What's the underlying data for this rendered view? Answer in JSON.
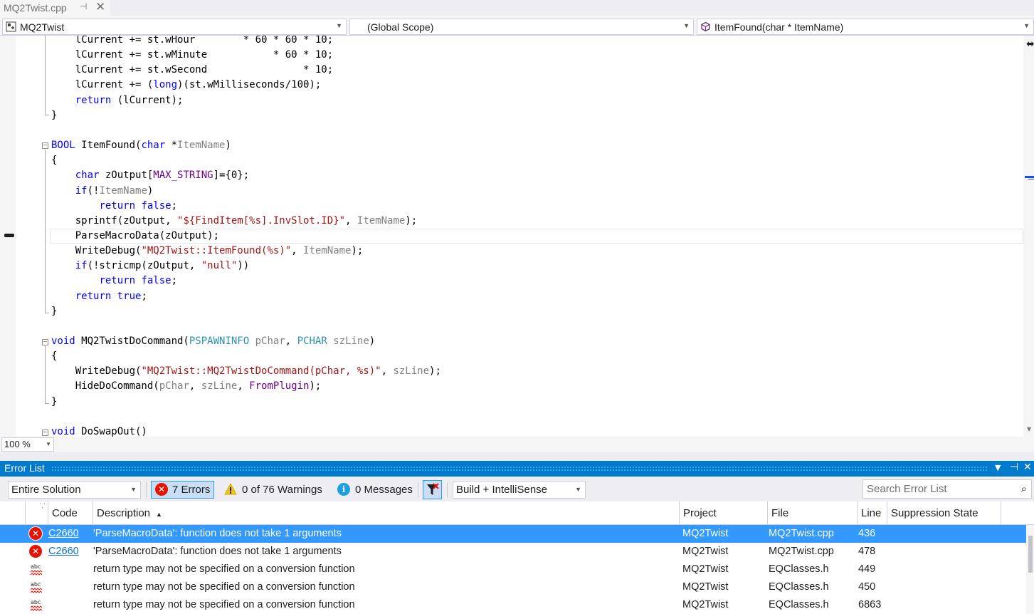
{
  "tab": {
    "filename": "MQ2Twist.cpp"
  },
  "navbar": {
    "project": "MQ2Twist",
    "scope": "(Global Scope)",
    "member": "ItemFound(char * ItemName)"
  },
  "zoom": "100 %",
  "code_lines": [
    [
      [
        "t",
        "    lCurrent += st.wHour        * 60 * 60 * 10;"
      ]
    ],
    [
      [
        "t",
        "    lCurrent += st.wMinute           * 60 * 10;"
      ]
    ],
    [
      [
        "t",
        "    lCurrent += st.wSecond                * 10;"
      ]
    ],
    [
      [
        "t",
        "    lCurrent += ("
      ],
      [
        "kw",
        "long"
      ],
      [
        "t",
        ")(st.wMilliseconds/100);"
      ]
    ],
    [
      [
        "t",
        "    "
      ],
      [
        "kw",
        "return"
      ],
      [
        "t",
        " (lCurrent);"
      ]
    ],
    [
      [
        "t",
        "}"
      ]
    ],
    [
      [
        "t",
        ""
      ]
    ],
    [
      [
        "kw",
        "BOOL"
      ],
      [
        "t",
        " ItemFound("
      ],
      [
        "kw",
        "char"
      ],
      [
        "t",
        " *"
      ],
      [
        "prm",
        "ItemName"
      ],
      [
        "t",
        ")"
      ]
    ],
    [
      [
        "t",
        "{"
      ]
    ],
    [
      [
        "t",
        "    "
      ],
      [
        "kw",
        "char"
      ],
      [
        "t",
        " zOutput["
      ],
      [
        "mac",
        "MAX_STRING"
      ],
      [
        "t",
        "]={0};"
      ]
    ],
    [
      [
        "t",
        "    "
      ],
      [
        "kw",
        "if"
      ],
      [
        "t",
        "(!"
      ],
      [
        "prm",
        "ItemName"
      ],
      [
        "t",
        ")"
      ]
    ],
    [
      [
        "t",
        "        "
      ],
      [
        "kw",
        "return"
      ],
      [
        "t",
        " "
      ],
      [
        "kw",
        "false"
      ],
      [
        "t",
        ";"
      ]
    ],
    [
      [
        "t",
        "    sprintf(zOutput, "
      ],
      [
        "str",
        "\"${FindItem[%s].InvSlot.ID}\""
      ],
      [
        "t",
        ", "
      ],
      [
        "prm",
        "ItemName"
      ],
      [
        "t",
        ");"
      ]
    ],
    [
      [
        "t",
        "    ParseMacroData(zOutput);"
      ]
    ],
    [
      [
        "t",
        "    WriteDebug("
      ],
      [
        "str",
        "\"MQ2Twist::ItemFound(%s)\""
      ],
      [
        "t",
        ", "
      ],
      [
        "prm",
        "ItemName"
      ],
      [
        "t",
        ");"
      ]
    ],
    [
      [
        "t",
        "    "
      ],
      [
        "kw",
        "if"
      ],
      [
        "t",
        "(!stricmp(zOutput, "
      ],
      [
        "str",
        "\"null\""
      ],
      [
        "t",
        "))"
      ]
    ],
    [
      [
        "t",
        "        "
      ],
      [
        "kw",
        "return"
      ],
      [
        "t",
        " "
      ],
      [
        "kw",
        "false"
      ],
      [
        "t",
        ";"
      ]
    ],
    [
      [
        "t",
        "    "
      ],
      [
        "kw",
        "return"
      ],
      [
        "t",
        " "
      ],
      [
        "kw",
        "true"
      ],
      [
        "t",
        ";"
      ]
    ],
    [
      [
        "t",
        "}"
      ]
    ],
    [
      [
        "t",
        ""
      ]
    ],
    [
      [
        "kw",
        "void"
      ],
      [
        "t",
        " MQ2TwistDoCommand("
      ],
      [
        "typ",
        "PSPAWNINFO"
      ],
      [
        "t",
        " "
      ],
      [
        "prm",
        "pChar"
      ],
      [
        "t",
        ", "
      ],
      [
        "typ",
        "PCHAR"
      ],
      [
        "t",
        " "
      ],
      [
        "prm",
        "szLine"
      ],
      [
        "t",
        ")"
      ]
    ],
    [
      [
        "t",
        "{"
      ]
    ],
    [
      [
        "t",
        "    WriteDebug("
      ],
      [
        "str",
        "\"MQ2Twist::MQ2TwistDoCommand(pChar, %s)\""
      ],
      [
        "t",
        ", "
      ],
      [
        "prm",
        "szLine"
      ],
      [
        "t",
        ");"
      ]
    ],
    [
      [
        "t",
        "    HideDoCommand("
      ],
      [
        "prm",
        "pChar"
      ],
      [
        "t",
        ", "
      ],
      [
        "prm",
        "szLine"
      ],
      [
        "t",
        ", "
      ],
      [
        "mac",
        "FromPlugin"
      ],
      [
        "t",
        ");"
      ]
    ],
    [
      [
        "t",
        "}"
      ]
    ],
    [
      [
        "t",
        ""
      ]
    ],
    [
      [
        "kw",
        "void"
      ],
      [
        "t",
        " DoSwapOut()"
      ]
    ]
  ],
  "error_list": {
    "title": "Error List",
    "scope": "Entire Solution",
    "errors_label": "7 Errors",
    "warnings_label": "0 of 76 Warnings",
    "messages_label": "0 Messages",
    "build_filter": "Build + IntelliSense",
    "search_placeholder": "Search Error List",
    "columns": {
      "code": "Code",
      "description": "Description",
      "project": "Project",
      "file": "File",
      "line": "Line",
      "suppression": "Suppression State"
    },
    "rows": [
      {
        "kind": "error",
        "code": "C2660",
        "description": "'ParseMacroData': function does not take 1 arguments",
        "project": "MQ2Twist",
        "file": "MQ2Twist.cpp",
        "line": "436",
        "selected": true
      },
      {
        "kind": "error",
        "code": "C2660",
        "description": "'ParseMacroData': function does not take 1 arguments",
        "project": "MQ2Twist",
        "file": "MQ2Twist.cpp",
        "line": "478",
        "selected": false
      },
      {
        "kind": "intellisense",
        "code": "",
        "description": "return type may not be specified on a conversion function",
        "project": "MQ2Twist",
        "file": "EQClasses.h",
        "line": "449",
        "selected": false
      },
      {
        "kind": "intellisense",
        "code": "",
        "description": "return type may not be specified on a conversion function",
        "project": "MQ2Twist",
        "file": "EQClasses.h",
        "line": "450",
        "selected": false
      },
      {
        "kind": "intellisense",
        "code": "",
        "description": "return type may not be specified on a conversion function",
        "project": "MQ2Twist",
        "file": "EQClasses.h",
        "line": "6863",
        "selected": false
      }
    ]
  },
  "icons": {
    "pin": "pin-icon",
    "close": "close-icon",
    "error": "error-icon",
    "warning": "warning-icon",
    "info": "info-icon",
    "filter": "filter-icon",
    "search": "search-icon",
    "spellcheck": "spellcheck-icon"
  },
  "colors": {
    "keyword": "#0000ff",
    "string": "#a31515",
    "macro": "#6f008a",
    "type": "#2b91af",
    "parameter": "#808080",
    "selection": "#3399ff",
    "panel_title": "#007acc",
    "error": "#e51400"
  }
}
